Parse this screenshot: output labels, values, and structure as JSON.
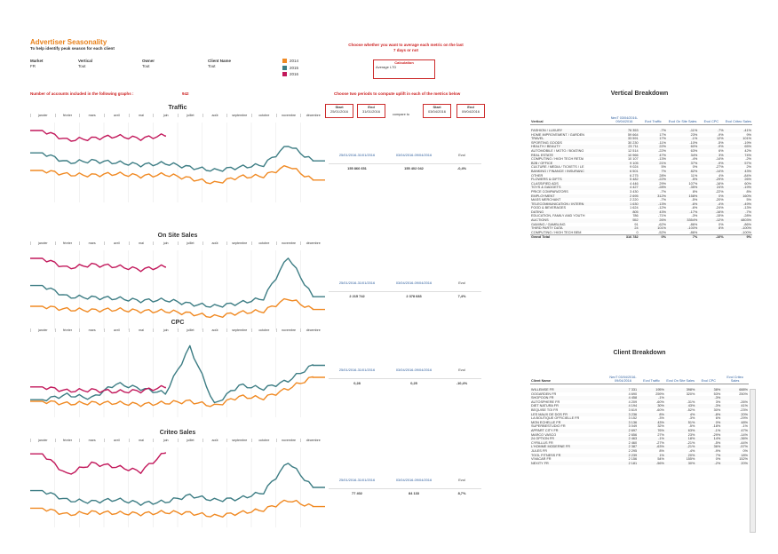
{
  "header": {
    "title": "Advertiser Seasonality",
    "subtitle": "To help identify peak season for each client",
    "filters": [
      {
        "label": "Market",
        "value": "FR"
      },
      {
        "label": "Vertical",
        "value": "Tout"
      },
      {
        "label": "Owner",
        "value": "Tout"
      },
      {
        "label": "Client Name",
        "value": "Tout"
      }
    ],
    "legend": [
      {
        "label": "2014",
        "color": "#f08a24"
      },
      {
        "label": "2015",
        "color": "#3d7d84"
      },
      {
        "label": "2016",
        "color": "#c2185b"
      }
    ],
    "average_note": "Choose whether you want to average each metric on the last 7 days or not",
    "calc_label": "Calculation",
    "calc_value": "Average L7D",
    "accounts_label": "Number of accounts included in the following graphs :",
    "accounts_count": "942",
    "periods_note": "Choose two periods to compute uplift in each of the metrics below"
  },
  "periods": {
    "p1_start_label": "Start",
    "p1_start": "25/01/2016",
    "p1_end_label": "End",
    "p1_end": "31/01/2016",
    "compare_to": "compare to",
    "p2_start_label": "Start",
    "p2_start": "03/04/2016",
    "p2_end_label": "End",
    "p2_end": "09/04/2016"
  },
  "metrics": [
    {
      "title": "Traffic",
      "range1": "25/01/2016-31/01/2016",
      "range2": "03/04/2016-09/04/2016",
      "evol_label": "Evol",
      "v1": "155 866 651",
      "v2": "155 402 042",
      "evol": "-0,4%"
    },
    {
      "title": "On Site Sales",
      "range1": "25/01/2016-31/01/2016",
      "range2": "03/04/2016-09/04/2016",
      "evol_label": "Evol",
      "v1": "2 215 742",
      "v2": "2 378 683",
      "evol": "7,4%"
    },
    {
      "title": "CPC",
      "range1": "25/01/2016-31/01/2016",
      "range2": "03/04/2016-09/04/2016",
      "evol_label": "Evol",
      "v1": "0,28",
      "v2": "0,25",
      "evol": "-10,4%"
    },
    {
      "title": "Criteo Sales",
      "range1": "25/01/2016-31/01/2016",
      "range2": "03/04/2016-09/04/2016",
      "evol_label": "Evol",
      "v1": "77 402",
      "v2": "84 133",
      "evol": "8,7%"
    }
  ],
  "months": [
    "janvier",
    "février",
    "mars",
    "avril",
    "mai",
    "juin",
    "juillet",
    "août",
    "septembre",
    "octobre",
    "novembre",
    "décembre"
  ],
  "chart_data": [
    {
      "type": "line",
      "title": "Traffic",
      "categories": [
        "janvier",
        "février",
        "mars",
        "avril",
        "mai",
        "juin",
        "juillet",
        "août",
        "septembre",
        "octobre",
        "novembre",
        "décembre"
      ],
      "series": [
        {
          "name": "2014",
          "values": [
            0.4,
            0.35,
            0.34,
            0.36,
            0.33,
            0.35,
            0.3,
            0.24,
            0.32,
            0.33,
            0.46,
            0.28
          ]
        },
        {
          "name": "2015",
          "values": [
            0.62,
            0.5,
            0.52,
            0.5,
            0.47,
            0.49,
            0.44,
            0.4,
            0.44,
            0.47,
            0.72,
            0.52
          ]
        },
        {
          "name": "2016",
          "values": [
            0.9,
            0.78,
            0.8,
            0.83,
            0.8,
            0.84
          ]
        }
      ]
    },
    {
      "type": "line",
      "title": "On Site Sales",
      "categories": [
        "janvier",
        "février",
        "mars",
        "avril",
        "mai",
        "juin",
        "juillet",
        "août",
        "septembre",
        "octobre",
        "novembre",
        "décembre"
      ],
      "series": [
        {
          "name": "2014",
          "values": [
            0.3,
            0.26,
            0.25,
            0.26,
            0.24,
            0.24,
            0.21,
            0.17,
            0.22,
            0.24,
            0.4,
            0.26
          ]
        },
        {
          "name": "2015",
          "values": [
            0.56,
            0.42,
            0.41,
            0.4,
            0.37,
            0.38,
            0.33,
            0.3,
            0.34,
            0.4,
            0.92,
            0.42
          ]
        },
        {
          "name": "2016",
          "values": [
            0.9,
            0.78,
            0.82,
            0.8,
            0.76,
            0.8
          ]
        }
      ]
    },
    {
      "type": "line",
      "title": "CPC",
      "categories": [
        "janvier",
        "février",
        "mars",
        "avril",
        "mai",
        "juin",
        "juillet",
        "août",
        "septembre",
        "octobre",
        "novembre",
        "décembre"
      ],
      "series": [
        {
          "name": "2014",
          "values": [
            0.2,
            0.17,
            0.18,
            0.18,
            0.16,
            0.18,
            0.2,
            0.14,
            0.26,
            0.24,
            0.36,
            0.5
          ]
        },
        {
          "name": "2015",
          "values": [
            0.22,
            0.28,
            0.24,
            0.42,
            0.36,
            0.3,
            0.88,
            0.16,
            0.4,
            0.36,
            0.46,
            0.65
          ]
        },
        {
          "name": "2016",
          "values": [
            0.38,
            0.33,
            0.34,
            0.32,
            0.33,
            0.38
          ]
        }
      ]
    },
    {
      "type": "line",
      "title": "Criteo Sales",
      "categories": [
        "janvier",
        "février",
        "mars",
        "avril",
        "mai",
        "juin",
        "juillet",
        "août",
        "septembre",
        "octobre",
        "novembre",
        "décembre"
      ],
      "series": [
        {
          "name": "2014",
          "values": [
            0.24,
            0.16,
            0.19,
            0.18,
            0.17,
            0.19,
            0.18,
            0.14,
            0.18,
            0.22,
            0.34,
            0.26
          ]
        },
        {
          "name": "2015",
          "values": [
            0.46,
            0.34,
            0.32,
            0.35,
            0.3,
            0.32,
            0.4,
            0.34,
            0.36,
            0.44,
            0.82,
            0.5
          ]
        },
        {
          "name": "2016",
          "values": [
            0.92,
            0.66,
            0.8,
            0.76,
            0.7,
            0.94
          ]
        }
      ]
    }
  ],
  "vertical_breakdown": {
    "title": "Vertical Breakdown",
    "columns": [
      "Vertical",
      "NexT 03/04/2016-09/04/2016",
      "Evol Traffic",
      "Evol On Site Sales",
      "Evol CPC",
      "Evol Criteo Sales"
    ],
    "rows": [
      [
        "FASHION / LUXURY",
        "76 353",
        "-7%",
        "-11%",
        "-7%",
        "-41%"
      ],
      [
        "HOME IMPROVEMENT / GARDEN",
        "59 664",
        "17%",
        "23%",
        "-9%",
        "9%"
      ],
      [
        "TRAVEL",
        "33 591",
        "17%",
        "-1%",
        "12%",
        "101%"
      ],
      [
        "SPORTING GOODS",
        "30 230",
        "-11%",
        "-10%",
        "-5%",
        "-19%"
      ],
      [
        "HEALTH / BEAUTY",
        "23 711",
        "22%",
        "60%",
        "-9%",
        "65%"
      ],
      [
        "AUTOMOBILE / MOTO / BOATING",
        "12 514",
        "-22%",
        "63%",
        "6%",
        "42%"
      ],
      [
        "REAL ESTATE",
        "10 966",
        "47%",
        "34%",
        "3%",
        "74%"
      ],
      [
        "COMPUTING / HIGH TECH RETAI",
        "10 107",
        "-13%",
        "-4%",
        "-14%",
        "-2%"
      ],
      [
        "B2B / OFFICE",
        "9 105",
        "21%",
        "37%",
        "-9%",
        "57%"
      ],
      [
        "CULTURE / MEDIA / TICKETS / LE",
        "9 024",
        "5%",
        "0%",
        "-27%",
        "2%"
      ],
      [
        "BANKING / FINANCE / INSURANC",
        "6 501",
        "7%",
        "82%",
        "-14%",
        "43%"
      ],
      [
        "OTHER",
        "6 275",
        "28%",
        "11%",
        "4%",
        "-84%"
      ],
      [
        "FLOWERS & GIFTS",
        "5 482",
        "-22%",
        "-5%",
        "-29%",
        "26%"
      ],
      [
        "CLASSIFIED ADS",
        "4 446",
        "29%",
        "107%",
        "-16%",
        "60%"
      ],
      [
        "TOYS & GADGETS",
        "4 427",
        "-28%",
        "-35%",
        "24%",
        "-19%"
      ],
      [
        "PRICE COMPARATORS",
        "3 430",
        "-7%",
        "8%",
        "-22%",
        "8%"
      ],
      [
        "EMPLOYMENT",
        "2 695",
        "312%",
        "158%",
        "0%",
        "160%"
      ],
      [
        "MASS MERCHANT",
        "2 220",
        "-7%",
        "-5%",
        "-20%",
        "5%"
      ],
      [
        "TELECOMMUNICATION / INTERN",
        "1 630",
        "-13%",
        "-6%",
        "-4%",
        "-49%"
      ],
      [
        "FOOD & BEVERAGES",
        "1 624",
        "-12%",
        "-6%",
        "-24%",
        "-13%"
      ],
      [
        "DATING",
        "805",
        "43%",
        "-17%",
        "-16%",
        "-7%"
      ],
      [
        "EDUCATION, FAMILY AND YOUTH",
        "786",
        "-71%",
        "-3%",
        "-15%",
        "-28%"
      ],
      [
        "AUCTIONS",
        "552",
        "26%",
        "3354%",
        "-12%",
        "4803%"
      ],
      [
        "GAMING / GAMBLING",
        "91",
        "-62%",
        "-86%",
        "0%",
        "-86%"
      ],
      [
        "THIRD PARTY DATA",
        "24",
        "101%",
        "-100%",
        "8%",
        "-100%"
      ],
      [
        "COMPUTING / HIGH TECH BEM",
        "0",
        "-52%",
        "-86%",
        "",
        "-100%"
      ]
    ],
    "total": [
      "Grand Total",
      "316 782",
      "0%",
      "7%",
      "-10%",
      "9%"
    ]
  },
  "client_breakdown": {
    "title": "Client Breakdown",
    "columns": [
      "Client Name",
      "NexT 03/04/2016-09/04/2016",
      "Evol Traffic",
      "Evol On Site Sales",
      "Evol CPC",
      "Evol Criteo Sales"
    ],
    "rows": [
      [
        "WILLEMSE FR",
        "7 331",
        "195%",
        "398%",
        "38%",
        "688%"
      ],
      [
        "OOGARDEN FR",
        "4 690",
        "259%",
        "320%",
        "53%",
        "250%"
      ],
      [
        "SHOPOON FR",
        "4 458",
        "-1%",
        "",
        "-3%",
        ""
      ],
      [
        "AUTOSPHERE FR",
        "4 209",
        "-60%",
        "-31%",
        "3%",
        "-26%"
      ],
      [
        "DIET NATURA FR",
        "4 194",
        "30%",
        "43%",
        "-3%",
        "41%"
      ],
      [
        "BEQUISE TOI FR",
        "3 619",
        "-60%",
        "-52%",
        "30%",
        "-23%"
      ],
      [
        "LES MAUX DE DOS FR",
        "3 236",
        "8%",
        "4%",
        "-8%",
        "20%"
      ],
      [
        "LA BOUTIQUE OFFICIELLE FR",
        "3 152",
        "-3%",
        "-3%",
        "6%",
        "-29%"
      ],
      [
        "MON ECHELLE FR",
        "3 136",
        "43%",
        "51%",
        "0%",
        "48%"
      ],
      [
        "SUPERBESTUDIO FR",
        "3 049",
        "32%",
        "-5%",
        "-18%",
        "-1%"
      ],
      [
        "APPART CITY FR",
        "2 697",
        "76%",
        "63%",
        "-1%",
        "47%"
      ],
      [
        "MARCO VASCO",
        "2 656",
        "27%",
        "23%",
        "-29%",
        "-14%"
      ],
      [
        "24 OPTION FR",
        "2 463",
        "-1%",
        "18%",
        "14%",
        "-36%"
      ],
      [
        "CYRILLUS FR",
        "2 460",
        "-27%",
        "-21%",
        "-5%",
        "-44%"
      ],
      [
        "L'HOMME MODERNE FR",
        "2 387",
        "-63%",
        "-21%",
        "36%",
        "-57%"
      ],
      [
        "JULES FR",
        "2 295",
        "8%",
        "-4%",
        "-9%",
        "0%"
      ],
      [
        "TOOL FITNESS FR",
        "2 239",
        "1%",
        "20%",
        "7%",
        "18%"
      ],
      [
        "VIVACAR FR",
        "2 156",
        "54%",
        "155%",
        "0%",
        "152%"
      ],
      [
        "NEXITY FR",
        "2 181",
        "-56%",
        "30%",
        "-2%",
        "20%"
      ]
    ]
  }
}
